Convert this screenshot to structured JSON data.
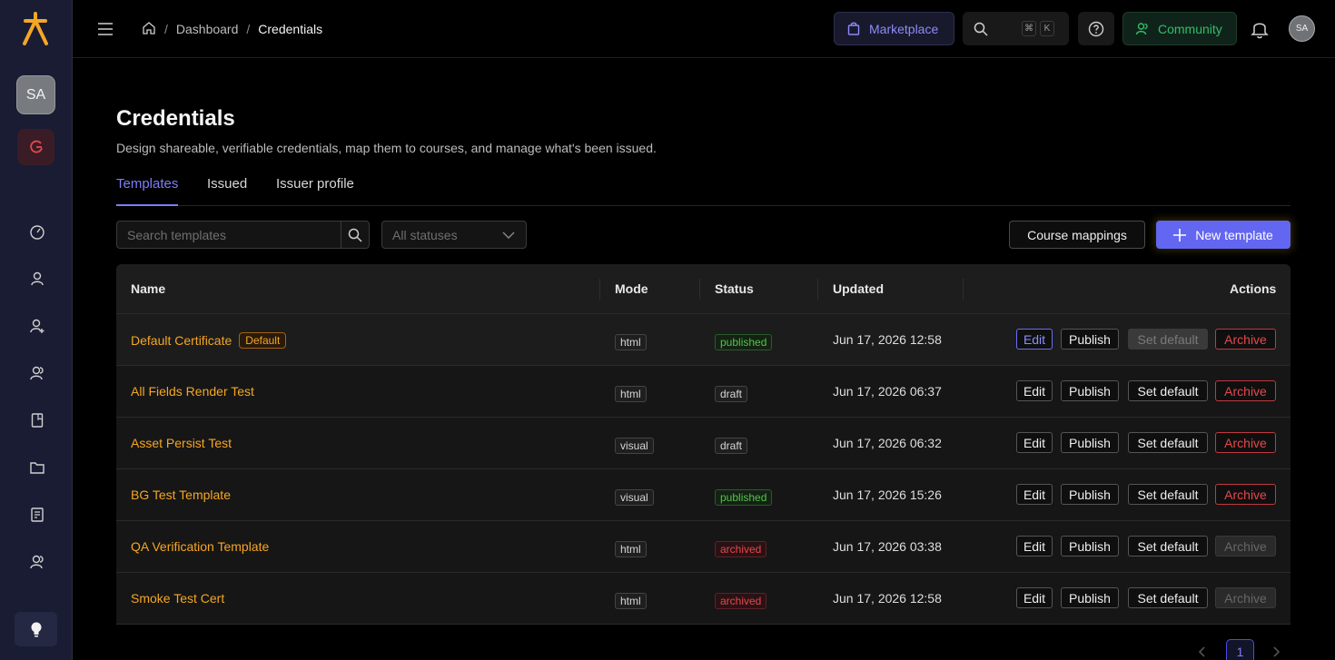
{
  "sidebar": {
    "avatar_initials": "SA",
    "icons": [
      "dashboard-icon",
      "user-icon",
      "user-add-icon",
      "users-icon",
      "book-icon",
      "folder-icon",
      "report-icon",
      "user-settings-icon"
    ]
  },
  "topbar": {
    "breadcrumb": {
      "home": "home-icon",
      "dashboard": "Dashboard",
      "separator": "/",
      "current": "Credentials"
    },
    "marketplace_label": "Marketplace",
    "shortcut_cmd": "⌘",
    "shortcut_key": "K",
    "community_label": "Community",
    "avatar_initials": "SA"
  },
  "page": {
    "title": "Credentials",
    "subtitle": "Design shareable, verifiable credentials, map them to courses, and manage what's been issued.",
    "tabs": [
      {
        "label": "Templates",
        "active": true
      },
      {
        "label": "Issued",
        "active": false
      },
      {
        "label": "Issuer profile",
        "active": false
      }
    ]
  },
  "filters": {
    "search_placeholder": "Search templates",
    "status_placeholder": "All statuses",
    "course_mappings_label": "Course mappings",
    "new_template_label": "New template"
  },
  "table": {
    "headers": {
      "name": "Name",
      "mode": "Mode",
      "status": "Status",
      "updated": "Updated",
      "actions": "Actions"
    },
    "action_labels": {
      "edit": "Edit",
      "publish": "Publish",
      "set_default": "Set default",
      "archive": "Archive"
    },
    "rows": [
      {
        "name": "Default Certificate",
        "badge": "Default",
        "mode": "html",
        "status": "published",
        "updated": "Jun 17, 2026 12:58"
      },
      {
        "name": "All Fields Render Test",
        "badge": "",
        "mode": "html",
        "status": "draft",
        "updated": "Jun 17, 2026 06:37"
      },
      {
        "name": "Asset Persist Test",
        "badge": "",
        "mode": "visual",
        "status": "draft",
        "updated": "Jun 17, 2026 06:32"
      },
      {
        "name": "BG Test Template",
        "badge": "",
        "mode": "visual",
        "status": "published",
        "updated": "Jun 17, 2026 15:26"
      },
      {
        "name": "QA Verification Template",
        "badge": "",
        "mode": "html",
        "status": "archived",
        "updated": "Jun 17, 2026 03:38"
      },
      {
        "name": "Smoke Test Cert",
        "badge": "",
        "mode": "html",
        "status": "archived",
        "updated": "Jun 17, 2026 12:58"
      }
    ]
  },
  "pagination": {
    "current_page": "1"
  },
  "colors": {
    "accent": "#6366f1",
    "link_orange": "#f5a623",
    "published_green": "#55c24e",
    "archived_red": "#e5484d",
    "community_green": "#2fbf6a"
  }
}
